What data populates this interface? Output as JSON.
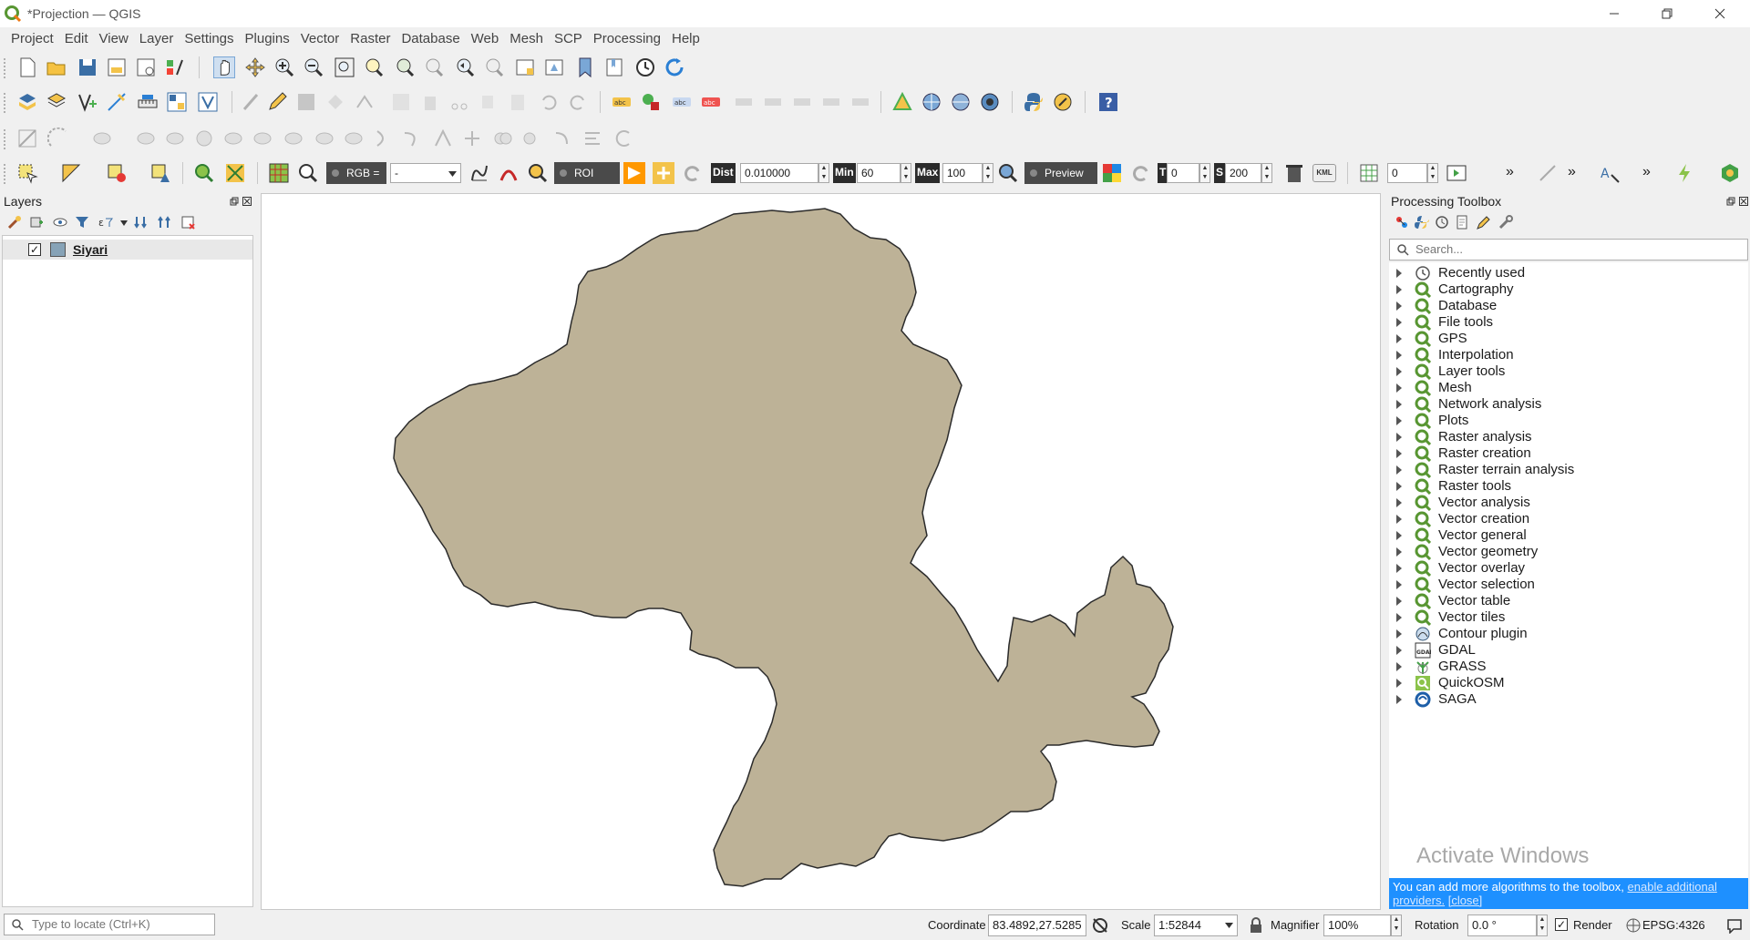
{
  "window": {
    "title": "*Projection — QGIS"
  },
  "menu": [
    "Project",
    "Edit",
    "View",
    "Layer",
    "Settings",
    "Plugins",
    "Vector",
    "Raster",
    "Database",
    "Web",
    "Mesh",
    "SCP",
    "Processing",
    "Help"
  ],
  "scp_toolbar": {
    "rgb_label": "RGB =",
    "rgb_value": "-",
    "roi_label": "ROI",
    "dist_label": "Dist",
    "dist_value": "0.010000",
    "min_label": "Min",
    "min_value": "60",
    "max_label": "Max",
    "max_value": "100",
    "preview_label": "Preview",
    "t_label": "T",
    "t_value": "0",
    "s_label": "S",
    "s_value": "200",
    "kml_label": "KML",
    "band_value": "0",
    "overflow": "»"
  },
  "layers_panel": {
    "title": "Layers",
    "layers": [
      {
        "name": "Siyari",
        "checked": true,
        "color": "#87a3b7"
      }
    ]
  },
  "map": {
    "polygon_fill": "#bdb297",
    "polygon_stroke": "#2b2b2b"
  },
  "toolbox": {
    "title": "Processing Toolbox",
    "search_placeholder": "Search...",
    "items": [
      {
        "label": "Recently used",
        "icon": "clock-icon"
      },
      {
        "label": "Cartography",
        "icon": "qgis-icon"
      },
      {
        "label": "Database",
        "icon": "qgis-icon"
      },
      {
        "label": "File tools",
        "icon": "qgis-icon"
      },
      {
        "label": "GPS",
        "icon": "qgis-icon"
      },
      {
        "label": "Interpolation",
        "icon": "qgis-icon"
      },
      {
        "label": "Layer tools",
        "icon": "qgis-icon"
      },
      {
        "label": "Mesh",
        "icon": "qgis-icon"
      },
      {
        "label": "Network analysis",
        "icon": "qgis-icon"
      },
      {
        "label": "Plots",
        "icon": "qgis-icon"
      },
      {
        "label": "Raster analysis",
        "icon": "qgis-icon"
      },
      {
        "label": "Raster creation",
        "icon": "qgis-icon"
      },
      {
        "label": "Raster terrain analysis",
        "icon": "qgis-icon"
      },
      {
        "label": "Raster tools",
        "icon": "qgis-icon"
      },
      {
        "label": "Vector analysis",
        "icon": "qgis-icon"
      },
      {
        "label": "Vector creation",
        "icon": "qgis-icon"
      },
      {
        "label": "Vector general",
        "icon": "qgis-icon"
      },
      {
        "label": "Vector geometry",
        "icon": "qgis-icon"
      },
      {
        "label": "Vector overlay",
        "icon": "qgis-icon"
      },
      {
        "label": "Vector selection",
        "icon": "qgis-icon"
      },
      {
        "label": "Vector table",
        "icon": "qgis-icon"
      },
      {
        "label": "Vector tiles",
        "icon": "qgis-icon"
      },
      {
        "label": "Contour plugin",
        "icon": "contour-icon"
      },
      {
        "label": "GDAL",
        "icon": "gdal-icon"
      },
      {
        "label": "GRASS",
        "icon": "grass-icon"
      },
      {
        "label": "QuickOSM",
        "icon": "quickosm-icon"
      },
      {
        "label": "SAGA",
        "icon": "saga-icon"
      }
    ],
    "watermark": "Activate Windows",
    "tip_text": "You can add more algorithms to the toolbox,",
    "tip_link": "enable additional providers.",
    "tip_close": "[close]"
  },
  "statusbar": {
    "locate_placeholder": "Type to locate (Ctrl+K)",
    "coordinate_label": "Coordinate",
    "coordinate_value": "83.4892,27.5285",
    "scale_label": "Scale",
    "scale_value": "1:52844",
    "magnifier_label": "Magnifier",
    "magnifier_value": "100%",
    "rotation_label": "Rotation",
    "rotation_value": "0.0 °",
    "render_label": "Render",
    "render_checked": true,
    "crs_label": "EPSG:4326"
  }
}
